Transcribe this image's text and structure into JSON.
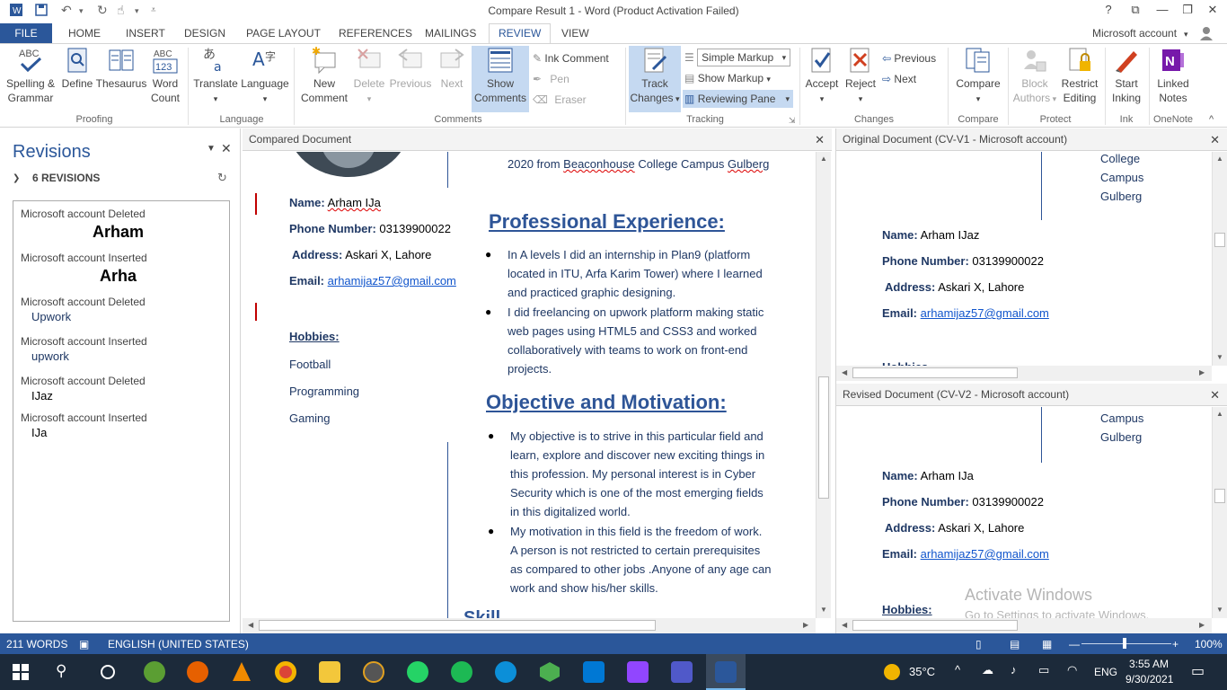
{
  "window": {
    "title": "Compare Result 1 - Word (Product Activation Failed)",
    "help": "?",
    "account": "Microsoft account"
  },
  "tabs": [
    "FILE",
    "HOME",
    "INSERT",
    "DESIGN",
    "PAGE LAYOUT",
    "REFERENCES",
    "MAILINGS",
    "REVIEW",
    "VIEW"
  ],
  "ribbon": {
    "proofing": {
      "spelling": "Spelling &",
      "spelling2": "Grammar",
      "define": "Define",
      "thesaurus": "Thesaurus",
      "wordcount": "Word",
      "wordcount2": "Count",
      "group": "Proofing"
    },
    "language": {
      "translate": "Translate",
      "language": "Language",
      "group": "Language"
    },
    "comments": {
      "new": "New",
      "new2": "Comment",
      "delete": "Delete",
      "previous": "Previous",
      "next": "Next",
      "show": "Show",
      "show2": "Comments",
      "ink": "Ink Comment",
      "pen": "Pen",
      "eraser": "Eraser",
      "group": "Comments"
    },
    "tracking": {
      "track": "Track",
      "track2": "Changes",
      "markup_select": "Simple Markup",
      "show_markup": "Show Markup",
      "reviewing_pane": "Reviewing Pane",
      "group": "Tracking"
    },
    "changes": {
      "accept": "Accept",
      "reject": "Reject",
      "previous": "Previous",
      "next": "Next",
      "group": "Changes"
    },
    "compare": {
      "compare": "Compare",
      "group": "Compare"
    },
    "protect": {
      "block": "Block",
      "block2": "Authors",
      "restrict": "Restrict",
      "restrict2": "Editing",
      "group": "Protect"
    },
    "ink": {
      "start": "Start",
      "start2": "Inking",
      "group": "Ink"
    },
    "onenote": {
      "linked": "Linked",
      "linked2": "Notes",
      "group": "OneNote"
    }
  },
  "revisions_pane": {
    "title": "Revisions",
    "count": "6 REVISIONS",
    "items": [
      {
        "author_action": "Microsoft account Deleted",
        "text": "Arham"
      },
      {
        "author_action": "Microsoft account Inserted",
        "text": "Arha"
      },
      {
        "author_action": "Microsoft account Deleted",
        "text": "Upwork"
      },
      {
        "author_action": "Microsoft account Inserted",
        "text": "upwork"
      },
      {
        "author_action": "Microsoft account Deleted",
        "text": "IJaz"
      },
      {
        "author_action": "Microsoft account Inserted",
        "text": "IJa"
      }
    ]
  },
  "compared": {
    "header": "Compared Document",
    "edu_line": "2020 from",
    "edu_link1": "Beaconhouse",
    "edu_mid": "College Campus",
    "edu_link2": "Gulberg",
    "name_label": "Name:",
    "name_value": "Arham IJa",
    "phone_label": "Phone Number:",
    "phone_value": "03139900022",
    "address_label": "Address:",
    "address_value": "Askari X, Lahore",
    "email_label": "Email:",
    "email_value": "arhamijaz57@gmail.com",
    "hobbies_label": "Hobbies:",
    "hobbies": [
      "Football",
      "Programming",
      "Gaming"
    ],
    "exp_heading": "Professional Experience:",
    "exp1": [
      "In A levels I did an internship in Plan9 (platform",
      "located in ITU, Arfa Karim Tower) where I learned",
      "and practiced graphic designing."
    ],
    "exp2": [
      " I did freelancing on upwork platform making static",
      "web pages using HTML5 and CSS3 and worked",
      "collaboratively with teams to work on front-end",
      "projects."
    ],
    "obj_heading": "Objective and Motivation:",
    "obj1": [
      "My objective is to strive in this particular field and",
      "learn, explore and discover new exciting things in",
      "this profession. My personal interest is in Cyber",
      "Security which is one of the most emerging fields",
      "in this digitalized world."
    ],
    "obj2": [
      "My motivation in this field is the freedom of work.",
      "A person is not restricted to certain prerequisites",
      "as compared to other jobs .Anyone of any age can",
      "work and show his/her skills."
    ],
    "skills_partial": "Skill"
  },
  "original": {
    "header": "Original Document (CV-V1 - Microsoft account)",
    "college": [
      "College",
      "Campus",
      "Gulberg"
    ],
    "name_value": "Arham IJaz",
    "partial": "Hobbies"
  },
  "revised": {
    "header": "Revised Document (CV-V2 - Microsoft account)",
    "campus": [
      "Campus",
      "Gulberg"
    ],
    "name_value": "Arham IJa",
    "hobbies_label": "Hobbies:"
  },
  "activate": {
    "line1": "Activate Windows",
    "line2": "Go to Settings to activate Windows."
  },
  "statusbar": {
    "words": "211 WORDS",
    "language": "ENGLISH (UNITED STATES)",
    "zoom": "100%"
  },
  "taskbar": {
    "temp": "35°C",
    "lang": "ENG",
    "time": "3:55 AM",
    "date": "9/30/2021"
  },
  "colors": {
    "word_blue": "#2b579a",
    "doc_text": "#1f3864",
    "heading": "#2e5597",
    "change_bar": "#c00000"
  }
}
